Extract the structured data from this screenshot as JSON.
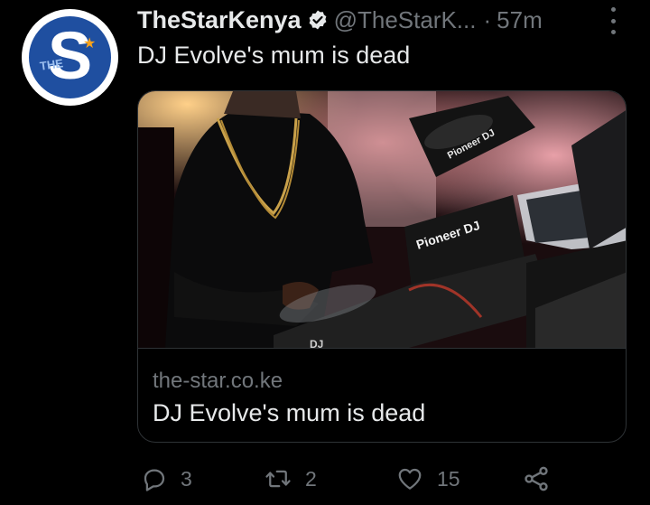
{
  "tweet": {
    "author_name": "TheStarKenya",
    "handle": "@TheStarK...",
    "separator": "·",
    "time": "57m",
    "text": "DJ Evolve's mum is dead",
    "avatar": {
      "letter": "S",
      "tag": "THE",
      "star": "★"
    }
  },
  "card": {
    "image_icon": "dj-photo",
    "image_texts": {
      "deck_top": "Pioneer DJ",
      "deck_front": "Pioneer DJ",
      "deck_bottom": "DJ"
    },
    "domain": "the-star.co.ke",
    "title": "DJ Evolve's mum is dead"
  },
  "actions": {
    "reply": {
      "icon": "reply-icon",
      "count": "3"
    },
    "retweet": {
      "icon": "retweet-icon",
      "count": "2"
    },
    "like": {
      "icon": "heart-icon",
      "count": "15"
    },
    "share": {
      "icon": "share-icon"
    }
  },
  "colors": {
    "background": "#000000",
    "text": "#e7e9ea",
    "muted": "#71767b",
    "avatar_blue": "#1f4fa0",
    "star_orange": "#f7a21b"
  }
}
